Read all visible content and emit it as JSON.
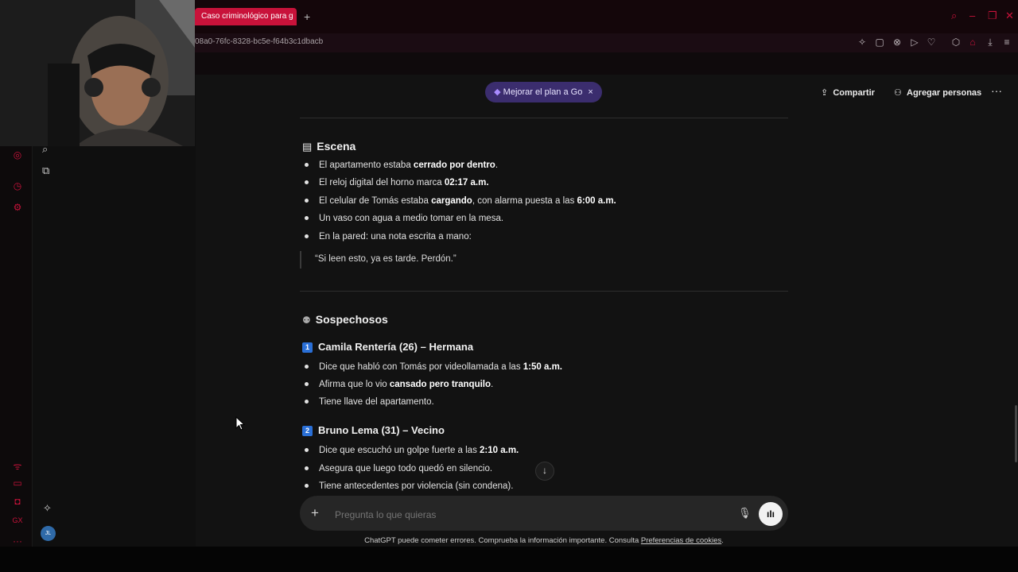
{
  "browser": {
    "tab_title": "Caso criminológico para g",
    "new_tab": "+",
    "url": "08a0-76fc-8328-bc5e-f64b3c1dbacb",
    "accent": "#c8123a"
  },
  "header": {
    "upgrade_label": "Mejorar el plan a Go",
    "upgrade_close": "×",
    "share_label": "Compartir",
    "add_people_label": "Agregar personas",
    "more_label": "···"
  },
  "scene": {
    "title": "Escena",
    "items": [
      {
        "pre": "El apartamento estaba ",
        "bold": "cerrado por dentro",
        "post": "."
      },
      {
        "pre": "El reloj digital del horno marca ",
        "bold": "02:17 a.m.",
        "post": ""
      },
      {
        "pre": "El celular de Tomás estaba ",
        "bold": "cargando",
        "post": ", con alarma puesta a las ",
        "bold2": "6:00 a.m."
      },
      {
        "pre": "Un vaso con agua a medio tomar en la mesa.",
        "bold": "",
        "post": ""
      },
      {
        "pre": "En la pared: una nota escrita a mano:",
        "bold": "",
        "post": ""
      }
    ],
    "quote": "“Si leen esto, ya es tarde. Perdón.”"
  },
  "suspects": {
    "title": "Sospechosos",
    "list": [
      {
        "num": "1",
        "name": "Camila Rentería (26) – Hermana",
        "items": [
          {
            "pre": "Dice que habló con Tomás por videollamada a las ",
            "bold": "1:50 a.m.",
            "post": ""
          },
          {
            "pre": "Afirma que lo vio ",
            "bold": "cansado pero tranquilo",
            "post": "."
          },
          {
            "pre": "Tiene llave del apartamento.",
            "bold": "",
            "post": ""
          }
        ]
      },
      {
        "num": "2",
        "name": "Bruno Lema (31) – Vecino",
        "items": [
          {
            "pre": "Dice que escuchó un golpe fuerte a las ",
            "bold": "2:10 a.m.",
            "post": ""
          },
          {
            "pre": "Asegura que luego todo quedó en silencio.",
            "bold": "",
            "post": ""
          },
          {
            "pre": "Tiene antecedentes por violencia (sin condena).",
            "bold": "",
            "post": ""
          }
        ]
      }
    ]
  },
  "composer": {
    "placeholder": "Pregunta lo que quieras"
  },
  "footer": {
    "disclaimer": "ChatGPT puede cometer errores. Comprueba la información importante. Consulta ",
    "cookies_link": "Preferencias de cookies",
    "end": "."
  }
}
